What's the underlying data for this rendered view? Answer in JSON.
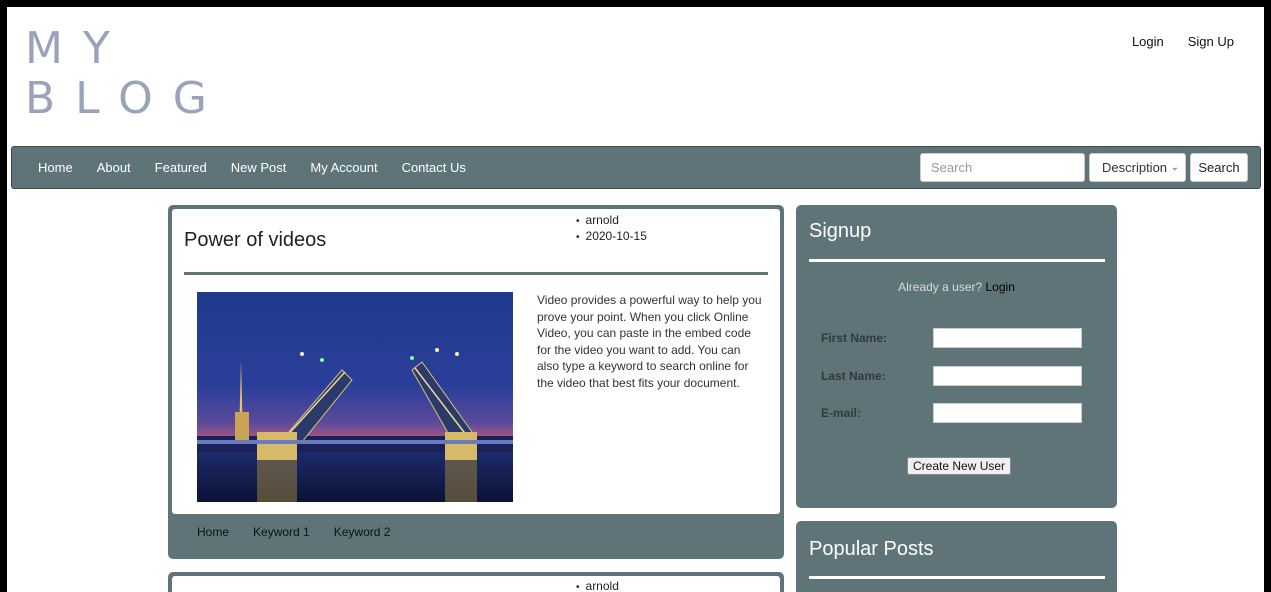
{
  "header": {
    "logo_line1": "MY",
    "logo_line2": "BLOG",
    "login_link": "Login",
    "signup_link": "Sign Up"
  },
  "nav": {
    "items": [
      "Home",
      "About",
      "Featured",
      "New Post",
      "My Account",
      "Contact Us"
    ],
    "search_placeholder": "Search",
    "filter_selected": "Description",
    "search_button": "Search"
  },
  "post": {
    "title": "Power of videos",
    "author": "arnold",
    "date": "2020-10-15",
    "body": "Video provides a powerful way to help you prove your point. When you click Online Video, you can paste in the embed code for the video you want to add. You can also type a keyword to search online for the video that best fits your document.",
    "tags": [
      "Home",
      "Keyword 1",
      "Keyword 2"
    ]
  },
  "post2": {
    "author": "arnold"
  },
  "signup": {
    "title": "Signup",
    "already_text": "Already a user?",
    "login_link": "Login",
    "first_name_label": "First Name:",
    "last_name_label": "Last Name:",
    "email_label": "E-mail:",
    "create_button": "Create New User"
  },
  "popular": {
    "title": "Popular Posts"
  },
  "colors": {
    "accent": "#5f7479",
    "logo": "#9aa3ba"
  }
}
